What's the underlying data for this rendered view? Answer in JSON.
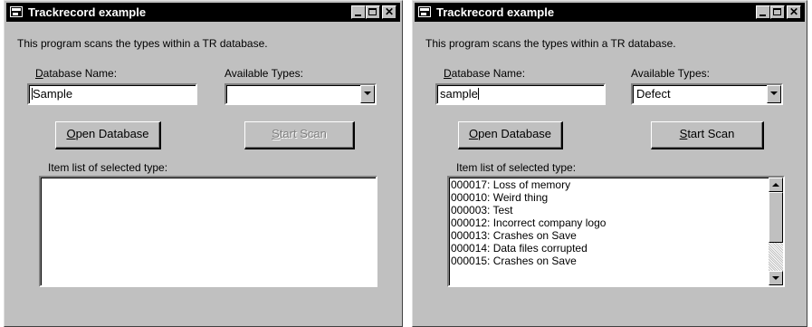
{
  "windows": [
    {
      "title": "Trackrecord example",
      "description": "This program scans the types within a TR database.",
      "database_label_mnemonic": "D",
      "database_label_rest": "atabase Name:",
      "database_value": "Sample",
      "types_label": "Available Types:",
      "selected_type": "",
      "open_mnemonic": "O",
      "open_rest": "pen Database",
      "scan_prefix": "",
      "scan_mnemonic": "S",
      "scan_rest": "tart Scan",
      "scan_enabled": false,
      "list_label": "Item list of selected type:",
      "items": []
    },
    {
      "title": "Trackrecord example",
      "description": "This program scans the types within a TR database.",
      "database_label_mnemonic": "D",
      "database_label_rest": "atabase Name:",
      "database_value": "sample",
      "types_label": "Available Types:",
      "selected_type": "Defect",
      "open_mnemonic": "O",
      "open_rest": "pen Database",
      "scan_mnemonic": "S",
      "scan_rest": "tart Scan",
      "scan_enabled": true,
      "list_label": "Item list of selected type:",
      "items": [
        "000017: Loss of memory",
        "000010: Weird thing",
        "000003: Test",
        "000012: Incorrect company logo",
        "000013: Crashes on Save",
        "000014: Data files corrupted",
        "000015: Crashes on Save"
      ]
    }
  ],
  "colors": {
    "titlebar": "#000000",
    "face": "#c0c0c0",
    "disabled_text": "#808080"
  },
  "icons": [
    "app-icon",
    "minimize-icon",
    "maximize-icon",
    "close-icon",
    "dropdown-arrow-icon",
    "scroll-up-icon",
    "scroll-down-icon"
  ]
}
